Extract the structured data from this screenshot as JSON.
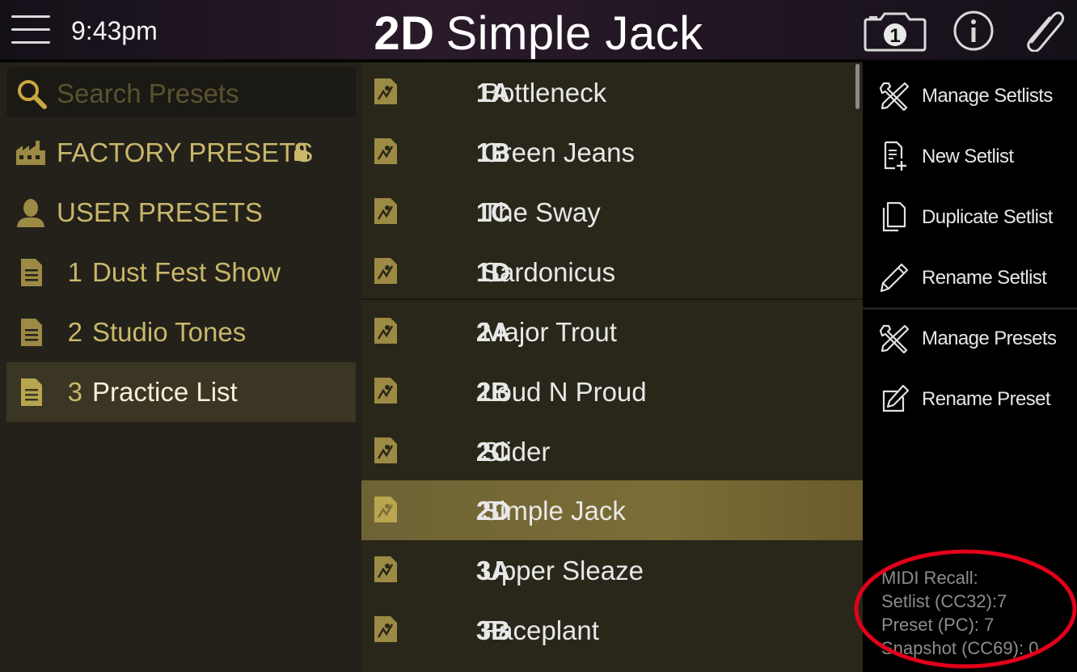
{
  "header": {
    "time": "9:43pm",
    "title_code": "2D",
    "title_name": "Simple Jack",
    "snapshot_number": "1",
    "icons": [
      "menu-icon",
      "snapshot-camera-icon",
      "info-icon",
      "paperclip-icon"
    ]
  },
  "sidebar": {
    "search_placeholder": "Search Presets",
    "factory_label": "FACTORY PRESETS",
    "user_label": "USER PRESETS",
    "setlists": [
      {
        "num": "1",
        "name": "Dust Fest Show"
      },
      {
        "num": "2",
        "name": "Studio Tones"
      },
      {
        "num": "3",
        "name": "Practice List"
      }
    ],
    "selected_setlist": "3"
  },
  "presets": [
    {
      "code": "1A",
      "name": "Bottleneck"
    },
    {
      "code": "1B",
      "name": "Green Jeans"
    },
    {
      "code": "1C",
      "name": "The Sway"
    },
    {
      "code": "1D",
      "name": "Sardonicus"
    },
    {
      "code": "2A",
      "name": "Major Trout"
    },
    {
      "code": "2B",
      "name": "Loud N Proud"
    },
    {
      "code": "2C",
      "name": "Slider"
    },
    {
      "code": "2D",
      "name": "Simple Jack"
    },
    {
      "code": "3A",
      "name": "Upper Sleaze"
    },
    {
      "code": "3B",
      "name": "Faceplant"
    }
  ],
  "selected_preset": "2D",
  "menu": {
    "manage_setlists": "Manage Setlists",
    "new_setlist": "New Setlist",
    "duplicate_setlist": "Duplicate Setlist",
    "rename_setlist": "Rename Setlist",
    "manage_presets": "Manage Presets",
    "rename_preset": "Rename Preset"
  },
  "midi": {
    "heading": "MIDI Recall:",
    "setlist": "Setlist (CC32):7",
    "preset": "Preset (PC): 7",
    "snapshot": "Snapshot (CC69): 0"
  },
  "colors": {
    "gold_text": "#c9b76a",
    "selected_preset_bg": "#7c6d36",
    "annotation_circle": "#e3001b"
  }
}
